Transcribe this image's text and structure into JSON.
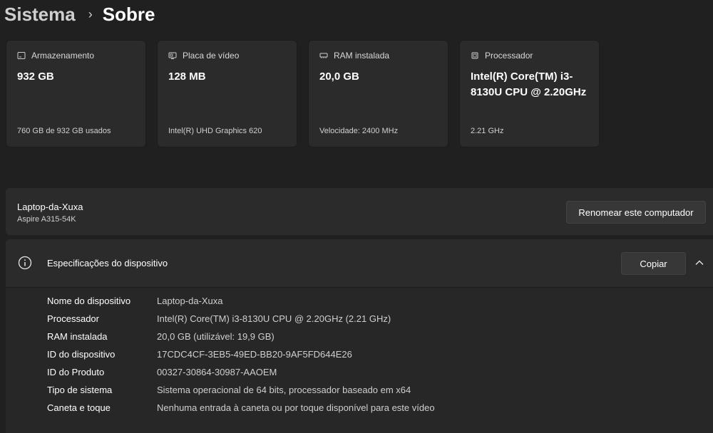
{
  "breadcrumb": {
    "parent": "Sistema",
    "separator": "›",
    "current": "Sobre"
  },
  "cards": [
    {
      "icon": "storage-icon",
      "title": "Armazenamento",
      "value": "932 GB",
      "sub": "760 GB de 932 GB usados"
    },
    {
      "icon": "gpu-icon",
      "title": "Placa de vídeo",
      "value": "128 MB",
      "sub": "Intel(R) UHD Graphics 620"
    },
    {
      "icon": "ram-icon",
      "title": "RAM instalada",
      "value": "20,0 GB",
      "sub": "Velocidade: 2400 MHz"
    },
    {
      "icon": "cpu-icon",
      "title": "Processador",
      "value": "Intel(R) Core(TM) i3-8130U CPU @ 2.20GHz",
      "sub": "2.21 GHz"
    }
  ],
  "device": {
    "name": "Laptop-da-Xuxa",
    "model": "Aspire A315-54K",
    "rename_label": "Renomear este computador"
  },
  "specs": {
    "title": "Especificações do dispositivo",
    "copy_label": "Copiar",
    "rows": [
      {
        "label": "Nome do dispositivo",
        "value": "Laptop-da-Xuxa"
      },
      {
        "label": "Processador",
        "value": "Intel(R) Core(TM) i3-8130U CPU @ 2.20GHz   (2.21 GHz)"
      },
      {
        "label": "RAM instalada",
        "value": "20,0 GB (utilizável: 19,9 GB)"
      },
      {
        "label": "ID do dispositivo",
        "value": "17CDC4CF-3EB5-49ED-BB20-9AF5FD644E26"
      },
      {
        "label": "ID do Produto",
        "value": "00327-30864-30987-AAOEM"
      },
      {
        "label": "Tipo de sistema",
        "value": "Sistema operacional de 64 bits, processador baseado em x64"
      },
      {
        "label": "Caneta e toque",
        "value": "Nenhuma entrada à caneta ou por toque disponível para este vídeo"
      }
    ]
  }
}
